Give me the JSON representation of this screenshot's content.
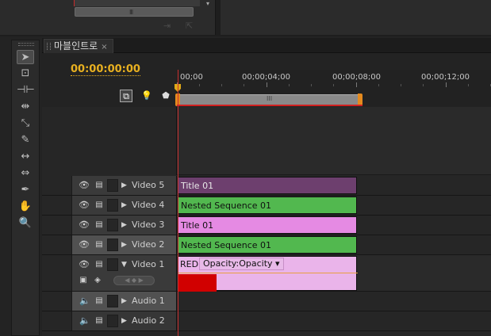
{
  "tab": {
    "title": "마블인트로",
    "close": "×"
  },
  "timecode": "00:00:00:00",
  "ruler": {
    "labels": [
      "00;00",
      "00;00;04;00",
      "00;00;08;00",
      "00;00;12;00"
    ],
    "work_area_grip": "III"
  },
  "top": {
    "scroll_grip": "III",
    "scroll_arrow": "▾"
  },
  "tracks": {
    "video5": {
      "name": "Video 5",
      "clip": "Title 01"
    },
    "video4": {
      "name": "Video 4",
      "clip": "Nested Sequence 01"
    },
    "video3": {
      "name": "Video 3",
      "clip": "Title 01"
    },
    "video2": {
      "name": "Video 2",
      "clip": "Nested Sequence 01"
    },
    "video1": {
      "name": "Video 1",
      "clip": "RED",
      "dropdown": "Opacity:Opacity ▾"
    },
    "audio1": {
      "name": "Audio 1"
    },
    "audio2": {
      "name": "Audio 2"
    }
  },
  "icons": {
    "eye": "👁",
    "film": "▤",
    "twirl_closed": "▶",
    "twirl_open": "▼",
    "speaker": "🔈"
  },
  "colors": {
    "timecode": "#e8b020",
    "title_clip_dark": "#6d3f6e",
    "nested_clip": "#52b84f",
    "title_clip_pink": "#e58ae3",
    "playhead": "#c83030",
    "work_area_handle": "#e58a1e"
  }
}
